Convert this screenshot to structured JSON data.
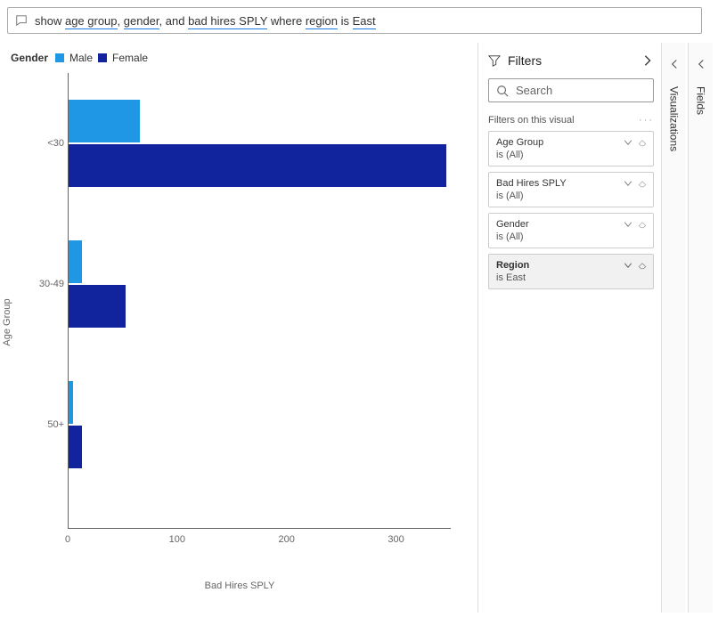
{
  "qna": {
    "prefix": "show ",
    "t1": "age group",
    "sep1": ", ",
    "t2": "gender",
    "sep2": ", and ",
    "t3": "bad hires SPLY",
    "sep3": " where ",
    "t4": "region",
    "sep4": " is ",
    "t5": "East"
  },
  "legend": {
    "title": "Gender",
    "male": "Male",
    "female": "Female"
  },
  "axes": {
    "y_title": "Age Group",
    "x_title": "Bad Hires SPLY"
  },
  "x_ticks": [
    "0",
    "100",
    "200",
    "300"
  ],
  "categories": {
    "c0": "<30",
    "c1": "30-49",
    "c2": "50+"
  },
  "colors": {
    "male": "#1f97e5",
    "female": "#12239e"
  },
  "filters": {
    "panel_title": "Filters",
    "search_placeholder": "Search",
    "section": "Filters on this visual",
    "cards": {
      "age": {
        "name": "Age Group",
        "state": "is (All)"
      },
      "bhs": {
        "name": "Bad Hires SPLY",
        "state": "is (All)"
      },
      "gender": {
        "name": "Gender",
        "state": "is (All)"
      },
      "region": {
        "name": "Region",
        "state": "is East"
      }
    }
  },
  "panes": {
    "viz": "Visualizations",
    "fields": "Fields"
  },
  "chart_data": {
    "type": "bar",
    "orientation": "horizontal",
    "grouped": true,
    "title": "",
    "xlabel": "Bad Hires SPLY",
    "ylabel": "Age Group",
    "xlim": [
      0,
      350
    ],
    "categories": [
      "<30",
      "30-49",
      "50+"
    ],
    "series": [
      {
        "name": "Male",
        "color": "#1f97e5",
        "values": [
          65,
          12,
          4
        ]
      },
      {
        "name": "Female",
        "color": "#12239e",
        "values": [
          345,
          52,
          12
        ]
      }
    ],
    "x_ticks": [
      0,
      100,
      200,
      300
    ],
    "legend_position": "top-left"
  }
}
